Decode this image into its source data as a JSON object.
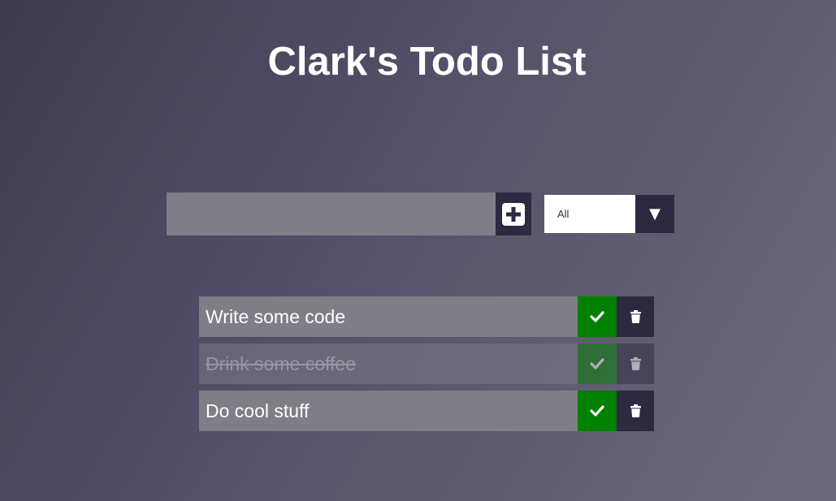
{
  "header": {
    "title": "Clark's Todo List"
  },
  "form": {
    "input_value": "",
    "add_icon": "plus-square-icon",
    "filter": {
      "selected": "All",
      "arrow_glyph": "▼"
    }
  },
  "todos": [
    {
      "text": "Write some code",
      "completed": false
    },
    {
      "text": "Drink some coffee",
      "completed": true
    },
    {
      "text": "Do cool stuff",
      "completed": false
    }
  ],
  "icons": {
    "complete": "check-icon",
    "delete": "trash-icon"
  },
  "colors": {
    "accent_dark": "#2e2840",
    "complete_green": "#028001",
    "item_bg": "#7f7d86",
    "title_text": "#ffffff"
  }
}
